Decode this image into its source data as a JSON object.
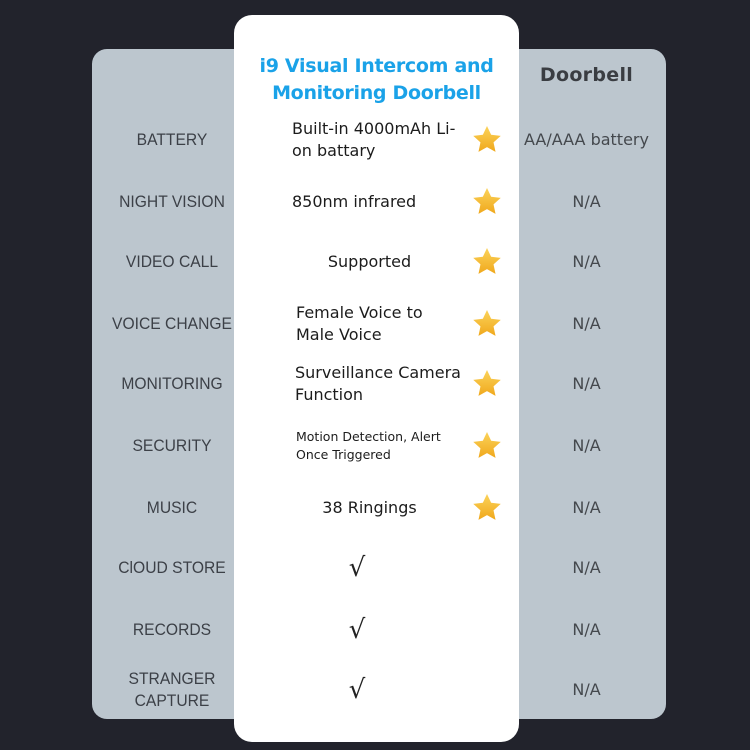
{
  "header": {
    "product_title": "i9 Visual Intercom and Monitoring Doorbell",
    "compare_title": "Doorbell"
  },
  "colors": {
    "background": "#22232c",
    "panel": "#bcc6ce",
    "card": "#ffffff",
    "title_blue": "#1aa2e8",
    "star_gold": "#f5b82a"
  },
  "rows": [
    {
      "label": "BATTERY",
      "feature": "Built-in 4000mAh Li-on battary",
      "mark": "star-icon",
      "compare": "AA/AAA battery"
    },
    {
      "label": "NIGHT VISION",
      "feature": "850nm infrared",
      "mark": "star-icon",
      "compare": "N/A"
    },
    {
      "label": "VIDEO CALL",
      "feature": "Supported",
      "mark": "star-icon",
      "compare": "N/A"
    },
    {
      "label": "VOICE CHANGE",
      "feature": "Female Voice to Male Voice",
      "mark": "star-icon",
      "compare": "N/A"
    },
    {
      "label": "MONITORING",
      "feature": "Surveillance Camera Function",
      "mark": "star-icon",
      "compare": "N/A"
    },
    {
      "label": "SECURITY",
      "feature": "Motion Detection, Alert Once Triggered",
      "mark": "star-icon",
      "compare": "N/A"
    },
    {
      "label": "MUSIC",
      "feature": "38 Ringings",
      "mark": "star-icon",
      "compare": "N/A"
    },
    {
      "label": "ClOUD STORE",
      "feature": "√",
      "mark": "check-icon",
      "compare": "N/A"
    },
    {
      "label": "RECORDS",
      "feature": "√",
      "mark": "check-icon",
      "compare": "N/A"
    },
    {
      "label": "STRANGER CAPTURE",
      "feature": "√",
      "mark": "check-icon",
      "compare": "N/A"
    }
  ]
}
